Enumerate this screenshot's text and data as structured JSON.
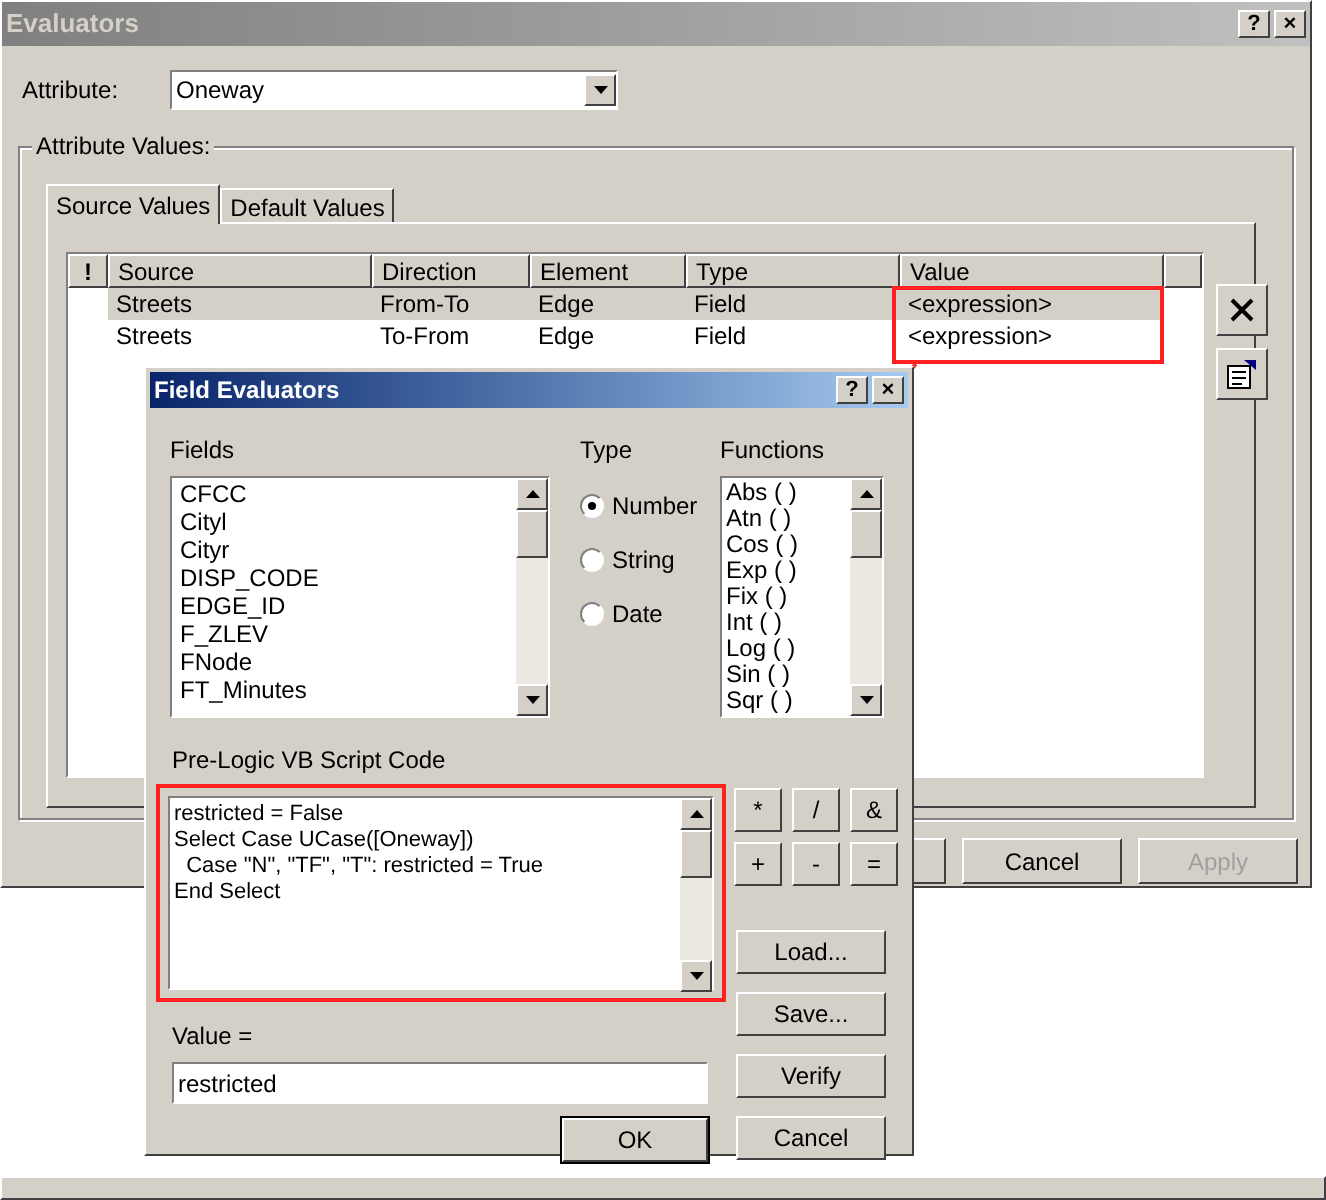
{
  "main_window": {
    "title": "Evaluators",
    "title_buttons": [
      "?",
      "×"
    ],
    "attribute_label": "Attribute:",
    "attribute_value": "Oneway",
    "group_label": "Attribute Values:",
    "tabs": [
      {
        "label": "Source Values",
        "selected": true
      },
      {
        "label": "Default Values",
        "selected": false
      }
    ],
    "table": {
      "columns": [
        "!",
        "Source",
        "Direction",
        "Element",
        "Type",
        "Value"
      ],
      "rows": [
        {
          "cells": [
            "",
            "Streets",
            "From-To",
            "Edge",
            "Field",
            "<expression>"
          ],
          "selected": true
        },
        {
          "cells": [
            "",
            "Streets",
            "To-From",
            "Edge",
            "Field",
            "<expression>"
          ],
          "selected": false
        }
      ]
    },
    "buttons": [
      {
        "label": "Cancel",
        "disabled": false
      },
      {
        "label": "Apply",
        "disabled": true
      }
    ]
  },
  "field_evaluators": {
    "title": "Field Evaluators",
    "title_buttons": [
      "?",
      "×"
    ],
    "fields_label": "Fields",
    "fields": [
      "CFCC",
      "Cityl",
      "Cityr",
      "DISP_CODE",
      "EDGE_ID",
      "F_ZLEV",
      "FNode",
      "FT_Minutes"
    ],
    "type_label": "Type",
    "types": [
      {
        "label": "Number",
        "selected": true
      },
      {
        "label": "String",
        "selected": false
      },
      {
        "label": "Date",
        "selected": false
      }
    ],
    "functions_label": "Functions",
    "functions": [
      "Abs ( )",
      "Atn ( )",
      "Cos ( )",
      "Exp ( )",
      "Fix ( )",
      "Int ( )",
      "Log ( )",
      "Sin ( )",
      "Sqr ( )"
    ],
    "code_label": "Pre-Logic VB Script Code",
    "code": "restricted = False\nSelect Case UCase([Oneway])\n  Case \"N\", \"TF\", \"T\": restricted = True\nEnd Select",
    "operators": [
      "*",
      "/",
      "&",
      "+",
      "-",
      "="
    ],
    "side_buttons": [
      "Load...",
      "Save...",
      "Verify",
      "Cancel"
    ],
    "value_label": "Value =",
    "value": "restricted",
    "ok": "OK"
  }
}
